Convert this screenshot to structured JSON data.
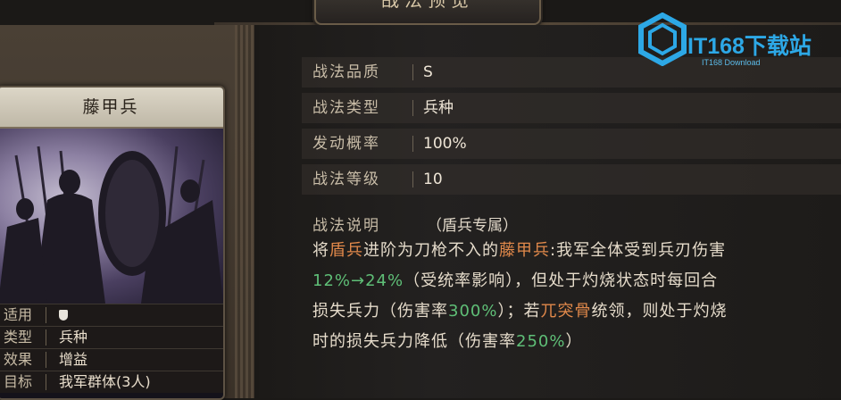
{
  "header": {
    "title": "战法预览"
  },
  "card": {
    "name": "藤甲兵",
    "info": [
      {
        "key": "适用",
        "value": "",
        "icon": "shield-icon"
      },
      {
        "key": "类型",
        "value": "兵种"
      },
      {
        "key": "效果",
        "value": "增益"
      },
      {
        "key": "目标",
        "value": "我军群体(3人)"
      }
    ]
  },
  "details": {
    "rows": [
      {
        "label": "战法品质",
        "value": "S"
      },
      {
        "label": "战法类型",
        "value": "兵种"
      },
      {
        "label": "发动概率",
        "value": "100%"
      },
      {
        "label": "战法等级",
        "value": "10"
      }
    ],
    "desc_label": "战法说明",
    "desc_note": "（盾兵专属）",
    "desc_lines": [
      [
        {
          "t": "将"
        },
        {
          "t": "盾兵",
          "c": "orange"
        },
        {
          "t": "进阶为刀枪不入的"
        },
        {
          "t": "藤甲兵",
          "c": "orange"
        },
        {
          "t": ":我军全体受到兵刃伤害"
        }
      ],
      [
        {
          "t": "12%→24%",
          "c": "green"
        },
        {
          "t": "（受统率影响），但处于灼烧状态时每回合"
        }
      ],
      [
        {
          "t": "损失兵力（伤害率"
        },
        {
          "t": "300%",
          "c": "green"
        },
        {
          "t": "）；若"
        },
        {
          "t": "兀突骨",
          "c": "orange"
        },
        {
          "t": "统领，则处于灼烧"
        }
      ],
      [
        {
          "t": "时的损失兵力降低（伤害率"
        },
        {
          "t": "250%",
          "c": "green"
        },
        {
          "t": "）"
        }
      ]
    ]
  },
  "watermark": {
    "main": "IT168下载站",
    "sub": "IT168 Download"
  },
  "colors": {
    "orange": "#e0884a",
    "green": "#5fbf77",
    "accent": "#2da8e6"
  }
}
